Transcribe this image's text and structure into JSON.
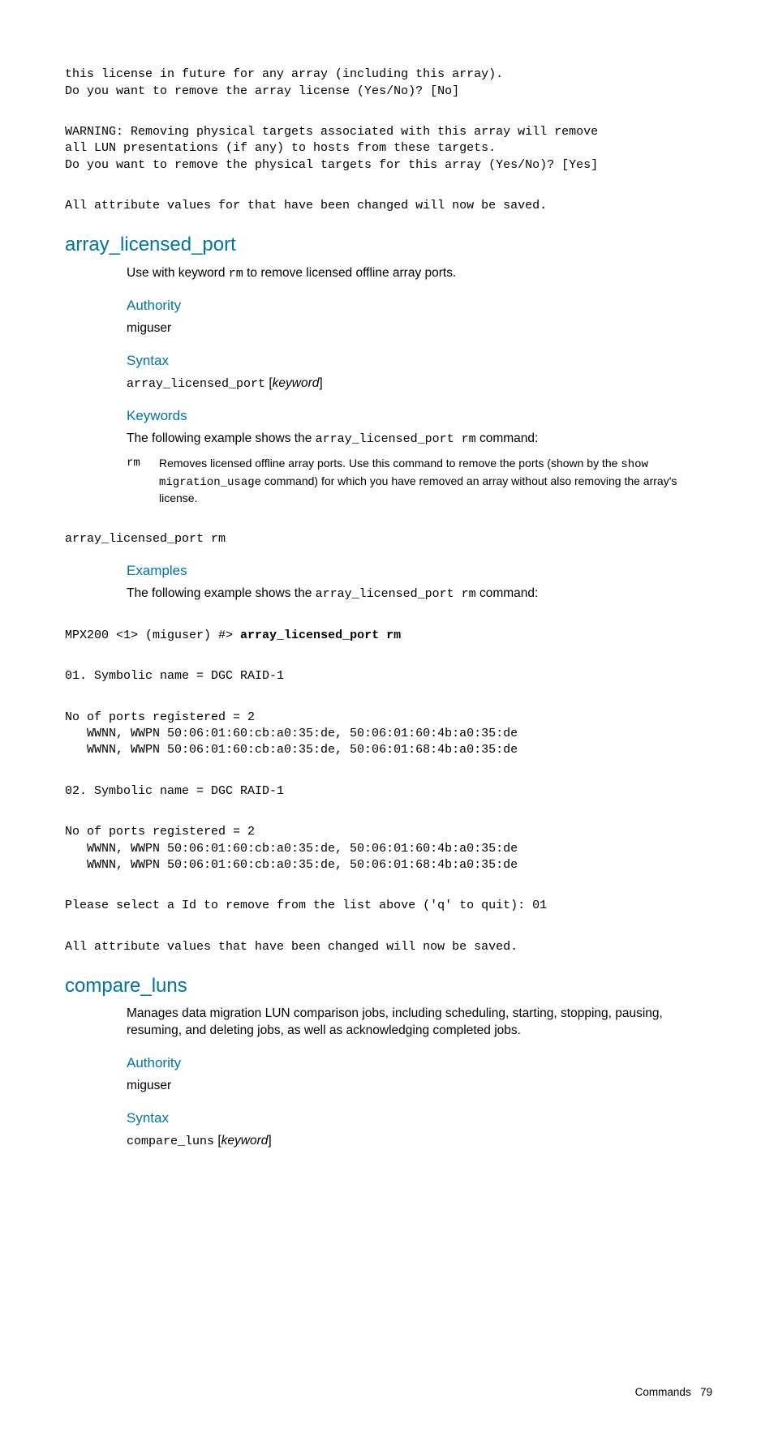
{
  "intro_block": {
    "line1": "this license in future for any array (including this array).",
    "line2": "Do you want to remove the array license (Yes/No)? [No]",
    "line3": "WARNING: Removing physical targets associated with this array will remove",
    "line4": "all LUN presentations (if any) to hosts from these targets.",
    "line5": "Do you want to remove the physical targets for this array (Yes/No)? [Yes]",
    "line6": "All attribute values for that have been changed will now be saved."
  },
  "section1": {
    "title": "array_licensed_port",
    "intro_pre": "Use with keyword ",
    "intro_code": "rm",
    "intro_post": " to remove licensed offline array ports.",
    "authority_h": "Authority",
    "authority_v": "miguser",
    "syntax_h": "Syntax",
    "syntax_code": "array_licensed_port",
    "syntax_open": " [",
    "syntax_kw": "keyword",
    "syntax_close": "]",
    "keywords_h": "Keywords",
    "keywords_intro_pre": "The following example shows the ",
    "keywords_intro_code": "array_licensed_port rm",
    "keywords_intro_post": " command:",
    "kw": {
      "key": "rm",
      "desc_pre": "Removes licensed offline array ports. Use this command to remove the ports (shown by the ",
      "desc_code1": "show",
      "desc_code2": "migration_usage",
      "desc_post": " command) for which you have removed an array without also removing the array's license."
    },
    "code_after_kw": "array_licensed_port rm",
    "examples_h": "Examples",
    "examples_intro_pre": "The following example shows the ",
    "examples_intro_code": "array_licensed_port rm",
    "examples_intro_post": " command:",
    "ex_prompt": "MPX200 <1> (miguser) #> ",
    "ex_cmd": "array_licensed_port rm",
    "ex_l1": "01. Symbolic name = DGC RAID-1",
    "ex_l2": "No of ports registered = 2",
    "ex_l3": "   WWNN, WWPN 50:06:01:60:cb:a0:35:de, 50:06:01:60:4b:a0:35:de",
    "ex_l4": "   WWNN, WWPN 50:06:01:60:cb:a0:35:de, 50:06:01:68:4b:a0:35:de",
    "ex_l5": "02. Symbolic name = DGC RAID-1",
    "ex_l6": "No of ports registered = 2",
    "ex_l7": "   WWNN, WWPN 50:06:01:60:cb:a0:35:de, 50:06:01:60:4b:a0:35:de",
    "ex_l8": "   WWNN, WWPN 50:06:01:60:cb:a0:35:de, 50:06:01:68:4b:a0:35:de",
    "ex_l9": "Please select a Id to remove from the list above ('q' to quit): 01",
    "ex_l10": "All attribute values that have been changed will now be saved."
  },
  "section2": {
    "title": "compare_luns",
    "intro": "Manages data migration LUN comparison jobs, including scheduling, starting, stopping, pausing, resuming, and deleting jobs, as well as acknowledging completed jobs.",
    "authority_h": "Authority",
    "authority_v": "miguser",
    "syntax_h": "Syntax",
    "syntax_code": "compare_luns",
    "syntax_open": " [",
    "syntax_kw": "keyword",
    "syntax_close": "]"
  },
  "footer": {
    "label": "Commands",
    "page": "79"
  }
}
